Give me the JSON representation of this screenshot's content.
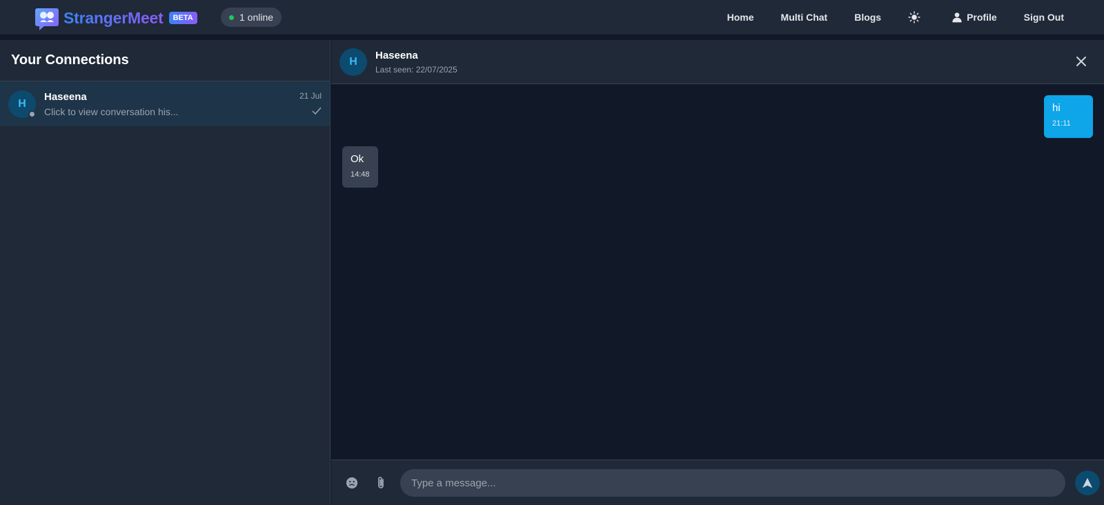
{
  "header": {
    "brand": "StrangerMeet",
    "beta": "BETA",
    "online": "1 online",
    "nav": {
      "home": "Home",
      "multi_chat": "Multi Chat",
      "blogs": "Blogs",
      "profile": "Profile",
      "sign_out": "Sign Out"
    },
    "icons": {
      "logo": "chat-bubble-logo-icon",
      "theme": "sun-icon",
      "profile": "user-icon"
    }
  },
  "sidebar": {
    "title": "Your Connections",
    "connections": [
      {
        "avatar": "H",
        "name": "Haseena",
        "preview": "Click to view conversation his...",
        "date": "21 Jul",
        "status": "offline"
      }
    ]
  },
  "chat": {
    "avatar": "H",
    "name": "Haseena",
    "last_seen": "Last seen: 22/07/2025",
    "messages": [
      {
        "direction": "outgoing",
        "text": "hi",
        "time": "21:11"
      },
      {
        "direction": "incoming",
        "text": "Ok",
        "time": "14:48"
      }
    ],
    "composer": {
      "placeholder": "Type a message..."
    }
  },
  "colors": {
    "background": "#111827",
    "panel": "#1f2937",
    "accent": "#0ea5e9",
    "brand_gradient": [
      "#3b82f6",
      "#8b5cf6"
    ],
    "online": "#22c55e"
  }
}
